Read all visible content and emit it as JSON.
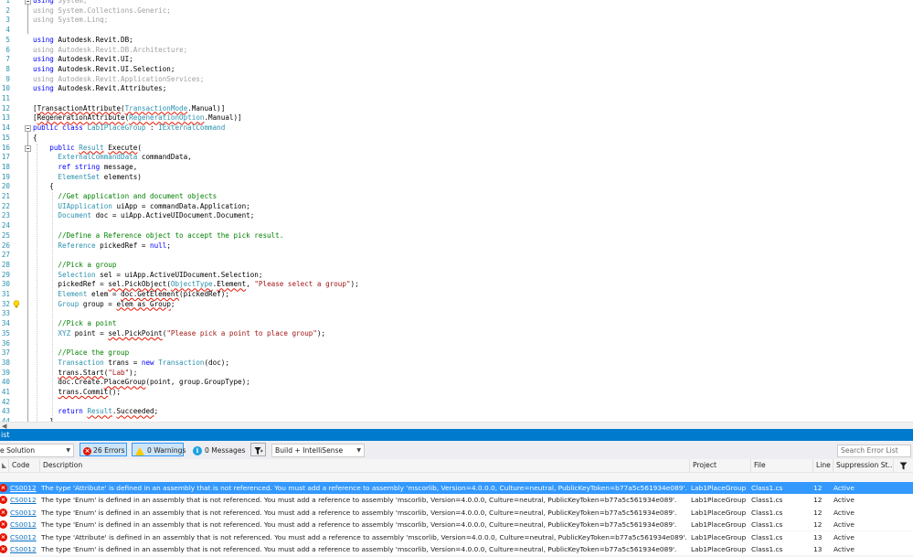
{
  "editor": {
    "line_numbers": [
      "1",
      "2",
      "3",
      "4",
      "5",
      "6",
      "7",
      "8",
      "9",
      "10",
      "11",
      "12",
      "13",
      "14",
      "15",
      "16",
      "17",
      "18",
      "19",
      "20",
      "21",
      "22",
      "23",
      "24",
      "25",
      "26",
      "27",
      "28",
      "29",
      "30",
      "31",
      "32",
      "33",
      "34",
      "35",
      "36",
      "37",
      "38",
      "39",
      "40",
      "41",
      "42",
      "43",
      "44"
    ],
    "lines": [
      [
        [
          "k",
          "using"
        ],
        [
          "g",
          " System;"
        ]
      ],
      [
        [
          "g",
          "using System.Collections.Generic;"
        ]
      ],
      [
        [
          "g",
          "using System.Linq;"
        ]
      ],
      [
        [
          "",
          ""
        ]
      ],
      [
        [
          "k",
          "using"
        ],
        [
          "",
          " Autodesk.Revit.DB;"
        ]
      ],
      [
        [
          "g",
          "using Autodesk.Revit.DB.Architecture;"
        ]
      ],
      [
        [
          "k",
          "using"
        ],
        [
          "",
          " Autodesk.Revit.UI;"
        ]
      ],
      [
        [
          "k",
          "using"
        ],
        [
          "",
          " Autodesk.Revit.UI.Selection;"
        ]
      ],
      [
        [
          "g",
          "using Autodesk.Revit.ApplicationServices;"
        ]
      ],
      [
        [
          "k",
          "using"
        ],
        [
          "",
          " Autodesk.Revit.Attributes;"
        ]
      ],
      [
        [
          "",
          ""
        ]
      ],
      [
        [
          "",
          "["
        ],
        [
          "sq",
          "TransactionAttribute"
        ],
        [
          "",
          "("
        ],
        [
          "t sq",
          "TransactionMode"
        ],
        [
          "",
          ".Manual)]"
        ]
      ],
      [
        [
          "",
          "["
        ],
        [
          "sq",
          "RegenerationAttribute"
        ],
        [
          "",
          "("
        ],
        [
          "t sq",
          "RegenerationOption"
        ],
        [
          "",
          ".Manual)]"
        ]
      ],
      [
        [
          "k",
          "public class "
        ],
        [
          "t",
          "Lab1PlaceGroup"
        ],
        [
          "",
          " : "
        ],
        [
          "t",
          "IExternalCommand"
        ]
      ],
      [
        [
          "",
          "{"
        ]
      ],
      [
        [
          "k",
          "    public "
        ],
        [
          "t sq",
          "Result"
        ],
        [
          "",
          " "
        ],
        [
          "sq",
          "Execute"
        ],
        [
          "",
          "("
        ]
      ],
      [
        [
          "t",
          "      ExternalCommandData"
        ],
        [
          "",
          " commandData,"
        ]
      ],
      [
        [
          "k",
          "      ref string"
        ],
        [
          "",
          " message,"
        ]
      ],
      [
        [
          "t",
          "      ElementSet"
        ],
        [
          "",
          " elements)"
        ]
      ],
      [
        [
          "",
          "    {"
        ]
      ],
      [
        [
          "c",
          "      //Get application and document objects"
        ]
      ],
      [
        [
          "t",
          "      UIApplication"
        ],
        [
          "",
          " uiApp = commandData.Application;"
        ]
      ],
      [
        [
          "t",
          "      Document"
        ],
        [
          "",
          " doc = uiApp.ActiveUIDocument.Document;"
        ]
      ],
      [
        [
          "",
          ""
        ]
      ],
      [
        [
          "c",
          "      //Define a Reference object to accept the pick result."
        ]
      ],
      [
        [
          "t",
          "      Reference"
        ],
        [
          "",
          " pickedRef = "
        ],
        [
          "k",
          "null"
        ],
        [
          "",
          ";"
        ]
      ],
      [
        [
          "",
          ""
        ]
      ],
      [
        [
          "c",
          "      //Pick a group"
        ]
      ],
      [
        [
          "t",
          "      Selection"
        ],
        [
          "",
          " sel = uiApp.ActiveUIDocument.Selection;"
        ]
      ],
      [
        [
          "",
          "      pickedRef = "
        ],
        [
          "sq",
          "sel.PickObject"
        ],
        [
          "",
          "("
        ],
        [
          "t sq",
          "ObjectType"
        ],
        [
          "",
          "."
        ],
        [
          "sq",
          "Element"
        ],
        [
          "",
          ", "
        ],
        [
          "s",
          "\"Please select a group\""
        ],
        [
          "",
          ");"
        ]
      ],
      [
        [
          "t",
          "      Element"
        ],
        [
          "",
          " elem = "
        ],
        [
          "sq",
          "doc.GetElement"
        ],
        [
          "",
          "(pickedRef);"
        ]
      ],
      [
        [
          "t",
          "      Group"
        ],
        [
          "",
          " group = "
        ],
        [
          "sq",
          "elem as Group"
        ],
        [
          "",
          ";"
        ]
      ],
      [
        [
          "",
          ""
        ]
      ],
      [
        [
          "c",
          "      //Pick a point"
        ]
      ],
      [
        [
          "t",
          "      XYZ"
        ],
        [
          "",
          " point = "
        ],
        [
          "sq",
          "sel.PickPoint"
        ],
        [
          "",
          "("
        ],
        [
          "s",
          "\"Please pick a point to place group\""
        ],
        [
          "",
          ");"
        ]
      ],
      [
        [
          "",
          ""
        ]
      ],
      [
        [
          "c",
          "      //Place the group"
        ]
      ],
      [
        [
          "t",
          "      Transaction"
        ],
        [
          "",
          " trans = "
        ],
        [
          "k",
          "new "
        ],
        [
          "t",
          "Transaction"
        ],
        [
          "",
          "(doc);"
        ]
      ],
      [
        [
          "",
          "      "
        ],
        [
          "sq",
          "trans.Start"
        ],
        [
          "",
          "("
        ],
        [
          "s",
          "\"Lab\""
        ],
        [
          "",
          ");"
        ]
      ],
      [
        [
          "",
          "      doc.Create."
        ],
        [
          "sq",
          "PlaceGroup"
        ],
        [
          "",
          "(point, group.GroupType);"
        ]
      ],
      [
        [
          "",
          "      "
        ],
        [
          "sq",
          "trans.Commit"
        ],
        [
          "",
          "();"
        ]
      ],
      [
        [
          "",
          ""
        ]
      ],
      [
        [
          "k",
          "      return "
        ],
        [
          "t sq",
          "Result"
        ],
        [
          "",
          "."
        ],
        [
          "sq",
          "Succeeded"
        ],
        [
          "",
          ";"
        ]
      ],
      [
        [
          "",
          "    }"
        ]
      ]
    ]
  },
  "error_list": {
    "title": "ist",
    "scope": "e Solution",
    "errors_label": "26 Errors",
    "warnings_label": "0 Warnings",
    "messages_label": "0 Messages",
    "build_filter": "Build + IntelliSense",
    "search_placeholder": "Search Error List",
    "columns": {
      "code": "Code",
      "description": "Description",
      "project": "Project",
      "file": "File",
      "line": "Line",
      "suppression": "Suppression St..."
    },
    "rows": [
      {
        "code": "CS0012",
        "description": "The type 'Attribute' is defined in an assembly that is not referenced. You must add a reference to assembly 'mscorlib, Version=4.0.0.0, Culture=neutral, PublicKeyToken=b77a5c561934e089'.",
        "project": "Lab1PlaceGroup",
        "file": "Class1.cs",
        "line": "12",
        "state": "Active"
      },
      {
        "code": "CS0012",
        "description": "The type 'Enum' is defined in an assembly that is not referenced. You must add a reference to assembly 'mscorlib, Version=4.0.0.0, Culture=neutral, PublicKeyToken=b77a5c561934e089'.",
        "project": "Lab1PlaceGroup",
        "file": "Class1.cs",
        "line": "12",
        "state": "Active"
      },
      {
        "code": "CS0012",
        "description": "The type 'Enum' is defined in an assembly that is not referenced. You must add a reference to assembly 'mscorlib, Version=4.0.0.0, Culture=neutral, PublicKeyToken=b77a5c561934e089'.",
        "project": "Lab1PlaceGroup",
        "file": "Class1.cs",
        "line": "12",
        "state": "Active"
      },
      {
        "code": "CS0012",
        "description": "The type 'Enum' is defined in an assembly that is not referenced. You must add a reference to assembly 'mscorlib, Version=4.0.0.0, Culture=neutral, PublicKeyToken=b77a5c561934e089'.",
        "project": "Lab1PlaceGroup",
        "file": "Class1.cs",
        "line": "12",
        "state": "Active"
      },
      {
        "code": "CS0012",
        "description": "The type 'Attribute' is defined in an assembly that is not referenced. You must add a reference to assembly 'mscorlib, Version=4.0.0.0, Culture=neutral, PublicKeyToken=b77a5c561934e089'.",
        "project": "Lab1PlaceGroup",
        "file": "Class1.cs",
        "line": "13",
        "state": "Active"
      },
      {
        "code": "CS0012",
        "description": "The type 'Enum' is defined in an assembly that is not referenced. You must add a reference to assembly 'mscorlib, Version=4.0.0.0, Culture=neutral, PublicKeyToken=b77a5c561934e089'.",
        "project": "Lab1PlaceGroup",
        "file": "Class1.cs",
        "line": "13",
        "state": "Active"
      }
    ]
  }
}
